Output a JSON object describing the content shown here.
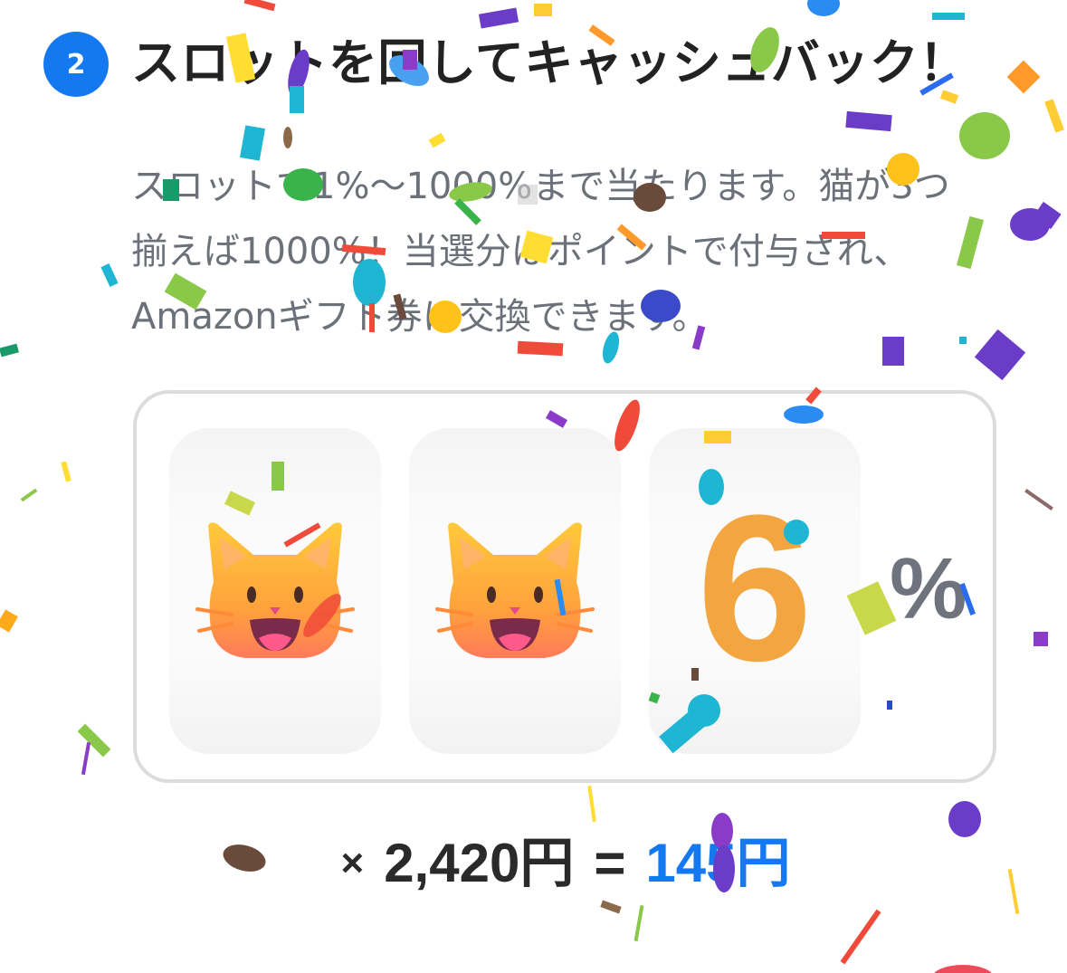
{
  "step": {
    "number": "2",
    "title": "スロットを回してキャッシュバック！"
  },
  "description": {
    "line1": "スロットで1%～1000%まで当たります。猫が3つ",
    "line2": "揃えば1000%！当選分はポイントで付与され、",
    "line3": "Amazonギフト券に交換できます。"
  },
  "slot": {
    "reels": [
      {
        "icon": "grinning-cat-icon"
      },
      {
        "icon": "grinning-cat-icon"
      },
      {
        "value": "6"
      }
    ],
    "unit": "%"
  },
  "formula": {
    "times": "×",
    "amount": "2,420円",
    "equals": "=",
    "result": "145円"
  },
  "colors": {
    "accent_blue": "#1479f0",
    "number_orange": "#f3a53f",
    "text_dark": "#222222",
    "text_gray": "#6b7079"
  }
}
